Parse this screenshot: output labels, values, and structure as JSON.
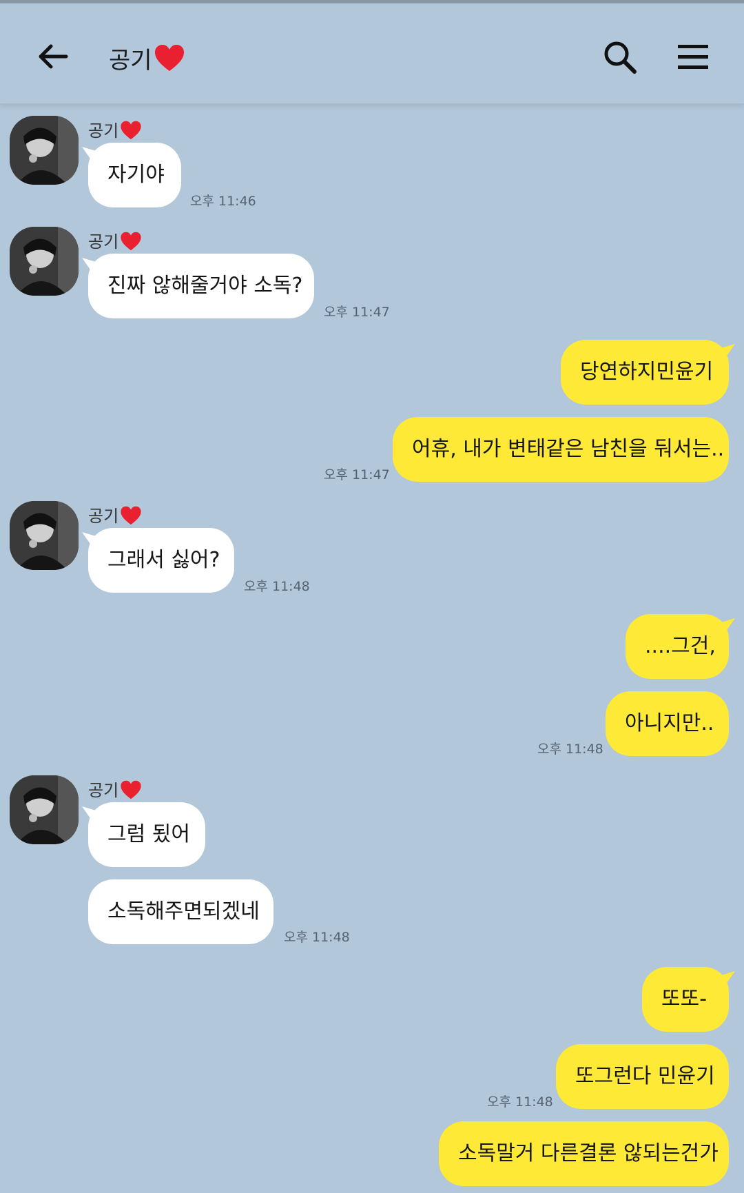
{
  "header": {
    "title": "공기",
    "back_icon": "arrow-left-icon",
    "search_icon": "search-icon",
    "menu_icon": "hamburger-menu-icon"
  },
  "colors": {
    "background": "#b2c7da",
    "incoming_bubble": "#ffffff",
    "outgoing_bubble": "#fee936",
    "heart": "#e8202f"
  },
  "contact": {
    "name": "공기",
    "heart_icon": "red-heart-icon",
    "avatar_icon": "profile-photo"
  },
  "messages": [
    {
      "side": "in",
      "text": "자기야",
      "time": "오후 11:46"
    },
    {
      "side": "in",
      "text": "진짜 않해줄거야 소독?",
      "time": "오후 11:47"
    },
    {
      "side": "out",
      "text": "당연하지민윤기",
      "time": ""
    },
    {
      "side": "out",
      "text": "어휴, 내가 변태같은 남친을 둬서는..",
      "time": "오후 11:47"
    },
    {
      "side": "in",
      "text": "그래서 싫어?",
      "time": "오후 11:48"
    },
    {
      "side": "out",
      "text": "....그건,",
      "time": ""
    },
    {
      "side": "out",
      "text": "아니지만..",
      "time": "오후 11:48"
    },
    {
      "side": "in",
      "text": "그럼 됬어",
      "time": ""
    },
    {
      "side": "in",
      "text": "소독해주면되겠네",
      "time": "오후 11:48"
    },
    {
      "side": "out",
      "text": "또또-",
      "time": ""
    },
    {
      "side": "out",
      "text": "또그런다 민윤기",
      "time": "오후 11:48"
    },
    {
      "side": "out",
      "text": "소독말거 다른결론 않되는건가",
      "time": ""
    }
  ]
}
